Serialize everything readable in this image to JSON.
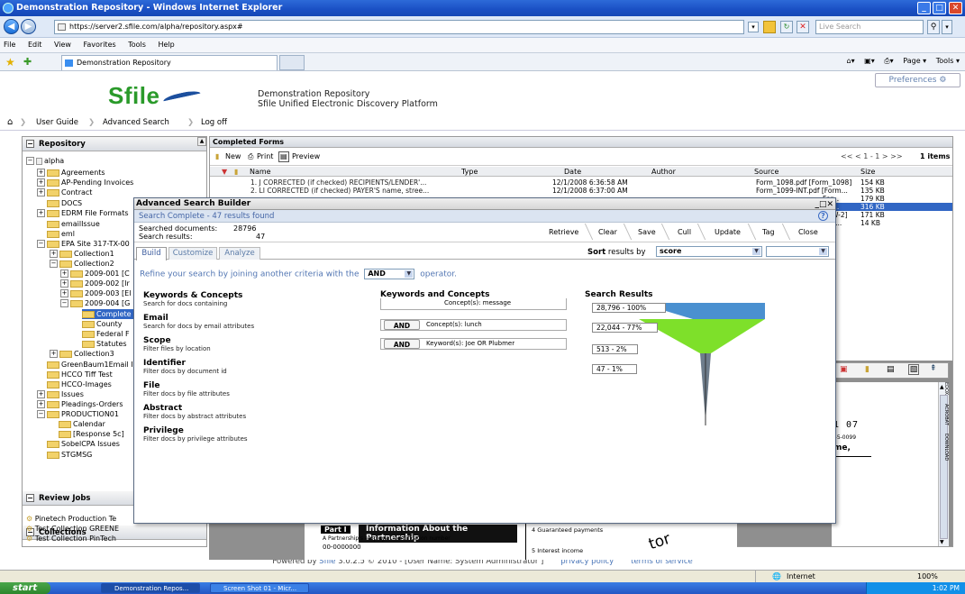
{
  "window": {
    "title": "Demonstration Repository - Windows Internet Explorer"
  },
  "browser": {
    "url": "https://server2.sfile.com/alpha/repository.aspx#",
    "search_placeholder": "Live Search",
    "menu": [
      "File",
      "Edit",
      "View",
      "Favorites",
      "Tools",
      "Help"
    ],
    "tab_title": "Demonstration Repository",
    "tools": [
      "Page ▾",
      "Tools ▾"
    ]
  },
  "app": {
    "logo": "Sfile",
    "title_line1": "Demonstration Repository",
    "title_line2": "Sfile Unified Electronic Discovery Platform",
    "preferences": "Preferences",
    "nav": [
      "User Guide",
      "Advanced Search",
      "Log off"
    ]
  },
  "repository": {
    "header": "Repository",
    "items": [
      "alpha",
      "Agreements",
      "AP-Pending Invoices",
      "Contract",
      "DOCS",
      "EDRM File Formats",
      "emailIssue",
      "eml",
      "EPA Site 317-TX-00",
      "Collection1",
      "Collection2",
      "2009-001 [C",
      "2009-002 [Ir",
      "2009-003 [El",
      "2009-004 [G",
      "Complete",
      "County",
      "Federal F",
      "Statutes",
      "Collection3",
      "GreenBaum1Email I",
      "HCCO Tiff Test",
      "HCCO-Images",
      "Issues",
      "Pleadings-Orders",
      "PRODUCTION01",
      "Calendar",
      "[Response 5c]",
      "SobelCPA Issues",
      "STGMSG"
    ],
    "review_jobs": "Review Jobs",
    "collections_header": "Collections",
    "collections": [
      "Pinetech Production Te",
      "Test Collection GREENE",
      "Test Collection PinTech"
    ]
  },
  "completed_forms": {
    "header": "Completed Forms",
    "toolbar": [
      "New",
      "Print",
      "Preview"
    ],
    "pager": "<<  <  1 - 1  >  >>",
    "count": "1 items",
    "columns": [
      "Name",
      "Type",
      "Date",
      "Author",
      "Source",
      "Size"
    ],
    "rows": [
      {
        "name": "1. J CORRECTED (if checked) RECIPIENTS/LENDER'...",
        "date": "12/1/2008 6:36:58 AM",
        "source": "Form_1098.pdf [Form_1098]",
        "size": "154 KB"
      },
      {
        "name": "2. LI CORRECTED (if checked) PAYER'S name, stree...",
        "date": "12/1/2008 6:37:00 AM",
        "source": "Form_1099-INT.pdf [Form...",
        "size": "135 KB"
      },
      {
        "name": "",
        "date": "",
        "source": "For...",
        "size": "179 KB"
      },
      {
        "name": "",
        "date": "",
        "source": "f [F...",
        "size": "316 KB"
      },
      {
        "name": "",
        "date": "",
        "source": "W-2]",
        "size": "171 KB"
      },
      {
        "name": "",
        "date": "",
        "source": "YZ ...",
        "size": "14 KB"
      }
    ]
  },
  "doc_preview": {
    "number": "1 07",
    "small": "45-0099",
    "name_fragment": "me,",
    "tabs": [
      "EDOX",
      "ACROBAT",
      "DOWNLOAD"
    ],
    "part_label": "Part I",
    "part_title": "Information About the Partnership",
    "line_a": "A  Partnership's employer identification number",
    "line_a_value": "00-0000000",
    "line4": "4    Guaranteed payments",
    "line5": "5    Interest income",
    "watermark": "tor"
  },
  "dialog": {
    "title": "Advanced Search Builder",
    "status": "Search Complete - 47 results found",
    "searched_label": "Searched documents:",
    "searched_value": "28796",
    "results_label": "Search results:",
    "results_value": "47",
    "actions": [
      "Retrieve",
      "Clear",
      "Save",
      "Cull",
      "Update",
      "Tag",
      "Close"
    ],
    "tabs": [
      "Build",
      "Customize",
      "Analyze"
    ],
    "sort_label_bold": "Sort",
    "sort_label": "results by",
    "sort_value": "score",
    "refine_before": "Refine your search by joining another criteria with the",
    "operator": "AND",
    "refine_after": "operator.",
    "criteria": [
      {
        "title": "Keywords & Concepts",
        "desc": "Search for docs containing"
      },
      {
        "title": "Email",
        "desc": "Search for docs by email attributes"
      },
      {
        "title": "Scope",
        "desc": "Filter files by location"
      },
      {
        "title": "Identifier",
        "desc": "Filter docs by document id"
      },
      {
        "title": "File",
        "desc": "Filter docs by file attributes"
      },
      {
        "title": "Abstract",
        "desc": "Filter docs by abstract attributes"
      },
      {
        "title": "Privilege",
        "desc": "Filter docs by privilege attributes"
      }
    ],
    "kw_title": "Keywords and Concepts",
    "kw_rows": [
      {
        "op": "",
        "text": "Concept(s): message"
      },
      {
        "op": "AND",
        "text": "Concept(s): lunch"
      },
      {
        "op": "AND",
        "text": "Keyword(s): Joe OR Plubmer"
      }
    ],
    "results_title": "Search Results",
    "results": [
      "28,796 - 100%",
      "22,044 - 77%",
      "513 - 2%",
      "47 - 1%"
    ],
    "funnel_colors": {
      "top": "#4a90d0",
      "middle": "#7ee02a"
    }
  },
  "footer": {
    "powered_prefix": "Powered by ",
    "powered_link": "Sfile",
    "powered_suffix": " 3.0.2.5 © 2010 - [User Name: System Administrator ]",
    "privacy": "privacy policy",
    "terms": "terms of service"
  },
  "statusbar": {
    "zone": "Internet",
    "zoom": "100%"
  },
  "taskbar": {
    "start": "start",
    "items": [
      "Demonstration Repos...",
      "Screen Shot 01 - Micr..."
    ],
    "time": "1:02 PM"
  }
}
